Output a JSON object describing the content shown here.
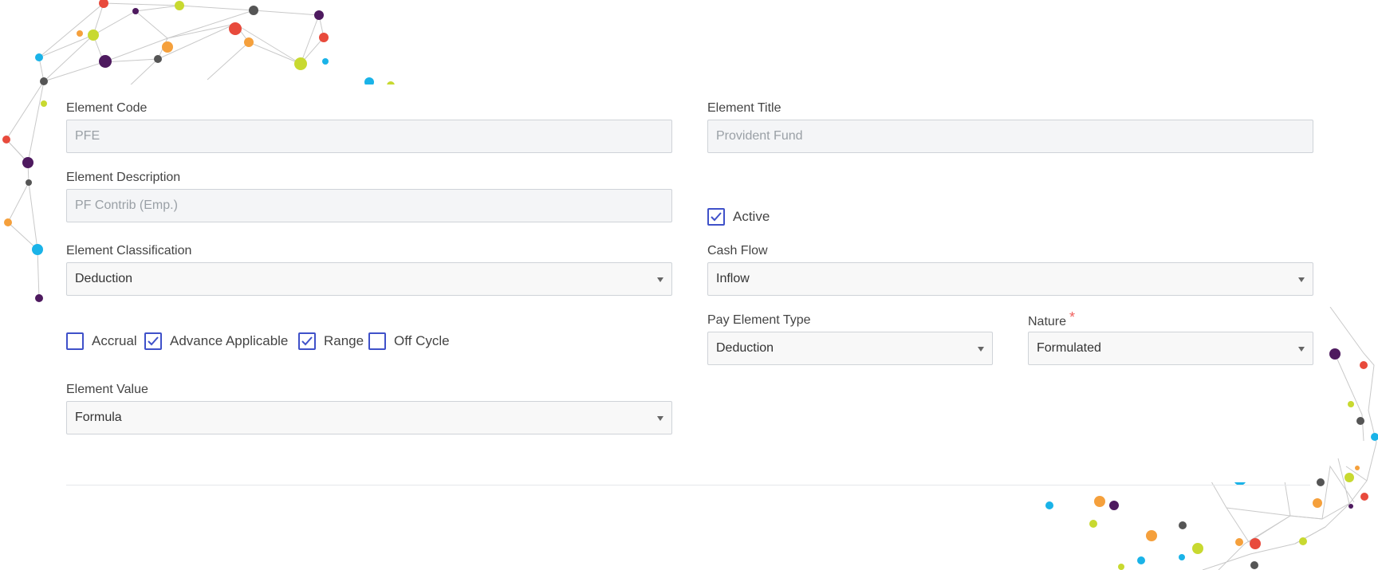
{
  "form": {
    "element_code": {
      "label": "Element Code",
      "value": "PFE"
    },
    "element_title": {
      "label": "Element Title",
      "value": "Provident Fund"
    },
    "element_description": {
      "label": "Element Description",
      "value": "PF Contrib (Emp.)"
    },
    "active": {
      "label": "Active",
      "checked": true
    },
    "element_classification": {
      "label": "Element Classification",
      "value": "Deduction"
    },
    "cash_flow": {
      "label": "Cash Flow",
      "value": "Inflow"
    },
    "checkboxes": [
      {
        "label": "Accrual",
        "checked": false
      },
      {
        "label": "Advance Applicable",
        "checked": true
      },
      {
        "label": "Range",
        "checked": true
      },
      {
        "label": "Off Cycle",
        "checked": false
      }
    ],
    "pay_element_type": {
      "label": "Pay Element Type",
      "value": "Deduction"
    },
    "nature": {
      "label": "Nature",
      "required_mark": "*",
      "value": "Formulated"
    },
    "element_value": {
      "label": "Element Value",
      "value": "Formula"
    }
  },
  "colors": {
    "checkbox_accent": "#3f51c9",
    "required": "#f0605d",
    "field_border": "#cfd3d8"
  }
}
